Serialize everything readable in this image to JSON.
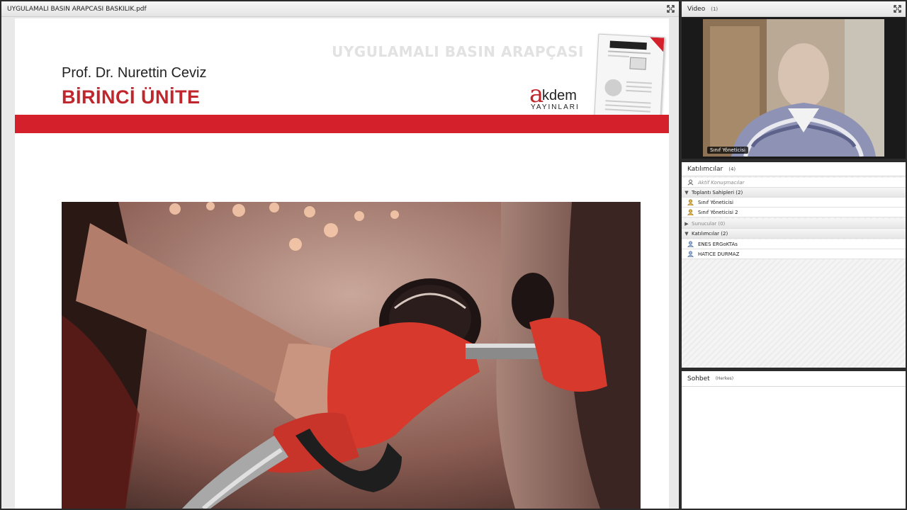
{
  "share_pod": {
    "title": "UYGULAMALI BASIN ARAPCASI BASKILIK.pdf",
    "slide": {
      "header_watermark": "UYGULAMALI BASIN ARAPÇASI",
      "author": "Prof. Dr. Nurettin Ceviz",
      "unit_title": "BİRİNCİ ÜNİTE",
      "logo": {
        "mark": "a",
        "name": "kdem",
        "sub": "YAYINLARI"
      },
      "accent_color": "#d4202a"
    }
  },
  "video_pod": {
    "title": "Video",
    "count": "(1)",
    "camera_label": "Sınıf Yöneticisi"
  },
  "attendees_pod": {
    "title": "Katılımcılar",
    "count": "(4)",
    "active_speakers": "Aktif Konuşmacılar",
    "groups": [
      {
        "label": "Toplantı Sahipleri (2)",
        "members": [
          "Sınıf Yöneticisi",
          "Sınıf Yöneticisi 2"
        ]
      },
      {
        "label": "Sunucular (0)",
        "members": []
      },
      {
        "label": "Katılımcılar (2)",
        "members": [
          "ENES ERGoKTAs",
          "HATICE DURMAZ"
        ]
      }
    ]
  },
  "chat_pod": {
    "title": "Sohbet",
    "scope": "(Herkes)"
  }
}
